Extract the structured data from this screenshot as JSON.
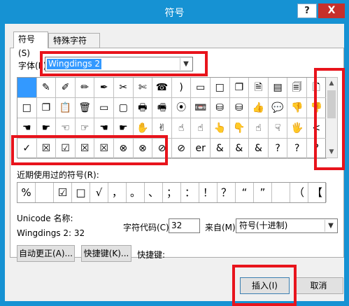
{
  "window": {
    "title": "符号",
    "help_glyph": "?",
    "close_glyph": "X"
  },
  "tabs": [
    {
      "label": "符号(S)",
      "active": true
    },
    {
      "label": "特殊字符(P)",
      "active": false
    }
  ],
  "font": {
    "label": "字体(F):",
    "value": "Wingdings 2"
  },
  "grid": {
    "rows": [
      [
        "",
        "✎",
        "✐",
        "✏",
        "✒",
        "✂",
        "✄",
        "☎",
        ")",
        "▭",
        "□",
        "❐",
        "🗎",
        "▤",
        "🗐",
        "🗋"
      ],
      [
        "□",
        "❐",
        "📋",
        "🗑",
        "▭",
        "▢",
        "🖶",
        "🖷",
        "⦿",
        "📼",
        "⛁",
        "⛁",
        "👍",
        "💬",
        "👎",
        "👎"
      ],
      [
        "☚",
        "☛",
        "☜",
        "☞",
        "☚",
        "☛",
        "✋",
        "✌",
        "☝",
        "☝",
        "👆",
        "👇",
        "☝",
        "☟",
        "🖐",
        "<"
      ],
      [
        "✓",
        "☒",
        "☑",
        "☒",
        "☒",
        "⊗",
        "⊗",
        "⊘",
        "⊘",
        "er",
        "&",
        "&",
        "&",
        "?",
        "?",
        "?"
      ]
    ]
  },
  "recent": {
    "label": "近期使用过的符号(R):",
    "symbols": [
      "%",
      "",
      "☑",
      "□",
      "√",
      "，",
      "。",
      "、",
      "；",
      "：",
      "！",
      "？",
      "“",
      "”",
      "",
      "（",
      "【"
    ]
  },
  "unicode": {
    "name_label": "Unicode 名称:",
    "name_value": "Wingdings 2: 32",
    "code_label": "字符代码(C):",
    "code_value": "32",
    "from_label": "来自(M):",
    "from_value": "符号(十进制)"
  },
  "buttons": {
    "autocorrect": "自动更正(A)...",
    "shortcut_key": "快捷键(K)...",
    "shortcut_label": "快捷键:",
    "insert": "插入(I)",
    "cancel": "取消"
  },
  "colors": {
    "titlebar": "#1692d3",
    "selection": "#3399ff",
    "annotation": "#e8141c",
    "close": "#c7302b"
  }
}
